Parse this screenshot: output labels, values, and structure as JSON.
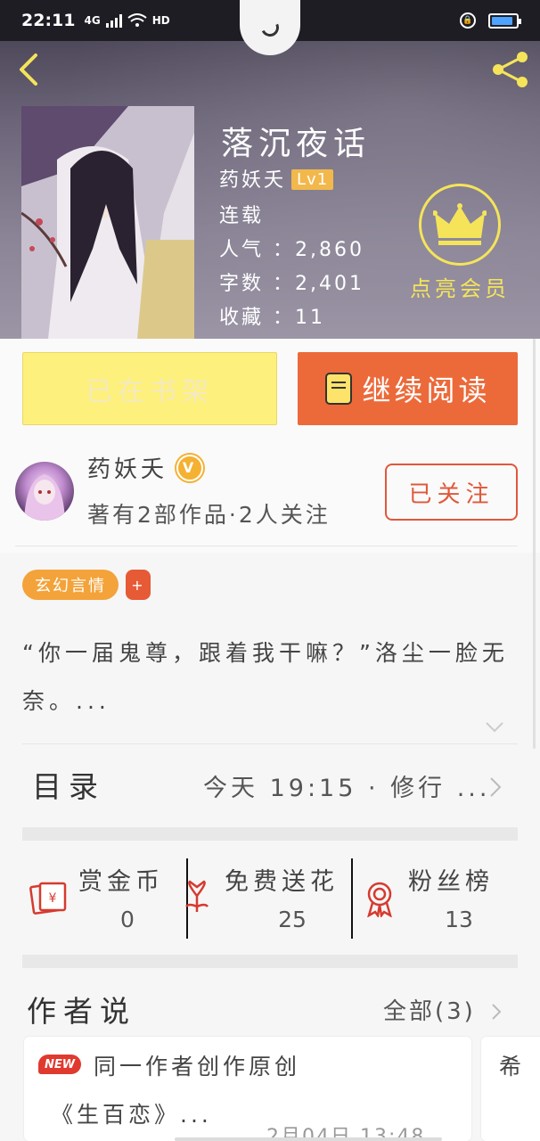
{
  "status_bar": {
    "time": "22:11",
    "network": "4G",
    "hd": "HD"
  },
  "book": {
    "title": "落沉夜话",
    "author": "药妖夭",
    "level": "Lv1",
    "status": "连载",
    "popularity_label": "人气",
    "popularity": "2,860",
    "words_label": "字数",
    "words": "2,401",
    "favorites_label": "收藏",
    "favorites": "11"
  },
  "vip": {
    "label": "点亮会员"
  },
  "actions": {
    "shelf_label": "已在书架",
    "read_label": "继续阅读"
  },
  "author": {
    "name": "药妖夭",
    "verified_badge": "V",
    "stats": "著有2部作品·2人关注",
    "follow_label": "已关注"
  },
  "tags": {
    "items": [
      "玄幻言情"
    ],
    "add_label": "+"
  },
  "description": "“你一届鬼尊，跟着我干嘛？”洛尘一脸无奈。...",
  "catalog": {
    "title": "目录",
    "latest": "今天 19:15 · 修行 ..."
  },
  "rewards": [
    {
      "label": "赏金币",
      "value": "0",
      "icon": "red-envelope-coin-icon"
    },
    {
      "label": "免费送花",
      "value": "25",
      "icon": "flower-icon"
    },
    {
      "label": "粉丝榜",
      "value": "13",
      "icon": "medal-icon"
    }
  ],
  "author_says": {
    "title": "作者说",
    "all_label": "全部(3)",
    "notes": [
      {
        "badge": "NEW",
        "title_line1": "同一作者创作原创",
        "title_line2": "《生百恋》...",
        "date": "2月04日 13:48"
      },
      {
        "text": "希"
      }
    ]
  },
  "colors": {
    "accent_orange": "#ec6a3a",
    "shelf_yellow": "#fef07c",
    "vip_yellow": "#f5e45a",
    "tag_orange": "#f3a33a"
  }
}
